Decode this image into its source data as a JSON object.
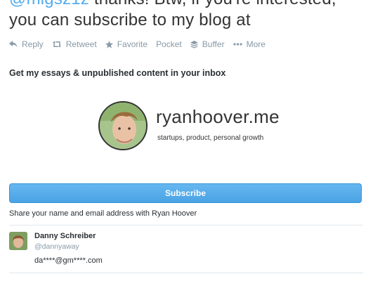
{
  "tweet": {
    "mention": "@migsz1z",
    "text_line1_rest": " thanks! Btw, if you're interested,",
    "text_line2": "you can subscribe to my blog at"
  },
  "actions": {
    "reply": "Reply",
    "retweet": "Retweet",
    "favorite": "Favorite",
    "pocket": "Pocket",
    "buffer": "Buffer",
    "more": "More"
  },
  "card": {
    "heading": "Get my essays & unpublished content in your inbox",
    "site": "ryanhoover.me",
    "tagline": "startups, product, personal growth",
    "subscribe_label": "Subscribe",
    "share_note": "Share your name and email address with Ryan Hoover"
  },
  "user": {
    "name": "Danny Schreiber",
    "handle": "@dannyaway",
    "email": "da****@gm****.com"
  },
  "colors": {
    "accent": "#55acee",
    "button": "#4aa3e4",
    "muted": "#8899a6",
    "divider": "#e1e8ed"
  }
}
